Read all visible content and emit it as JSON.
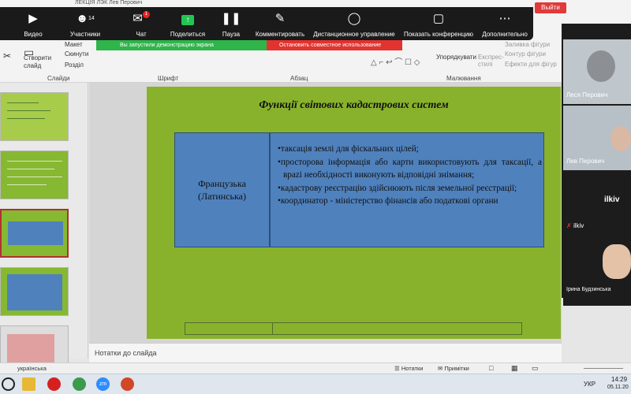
{
  "window": {
    "title_fragment": "ЛЕКЦІЯ ЛЭК   Лев Перович"
  },
  "zoom": {
    "buttons": [
      {
        "label": "Видео",
        "icon": "video-icon"
      },
      {
        "label": "Участники",
        "icon": "participants-icon",
        "count": "14"
      },
      {
        "label": "Чат",
        "icon": "chat-icon",
        "badge": "1"
      },
      {
        "label": "Поделиться",
        "icon": "share-icon"
      },
      {
        "label": "Пауза",
        "icon": "pause-icon"
      },
      {
        "label": "Комментировать",
        "icon": "annotate-icon"
      },
      {
        "label": "Дистанционное управление",
        "icon": "remote-control-icon"
      },
      {
        "label": "Показать конференцию",
        "icon": "show-meeting-icon"
      },
      {
        "label": "Дополнительно",
        "icon": "more-icon"
      }
    ],
    "leave_label": "Выйти",
    "sharing_text": "Вы запустили демонстрацию экрана",
    "stop_sharing_text": "Остановить совместное использование"
  },
  "ribbon": {
    "new_slide": "Створити слайд",
    "layout": "Макет",
    "reset": "Скинути",
    "section": "Розділ",
    "groups": [
      "Слайди",
      "Шрифт",
      "Абзац",
      "Малювання"
    ],
    "arrange": "Упорядкувати",
    "quick_styles": "Експрес-стилі",
    "shape_fill": "Заливка фігури",
    "shape_outline": "Контур фігури",
    "shape_effects": "Ефекти для фігур"
  },
  "slide": {
    "title": "Функції світових кадастрових систем",
    "left_cell": "Французька (Латинська)",
    "bullets": [
      "таксація землі для фіскальних цілей;",
      "просторова інформація або карти використовують для таксації, а врazi необхідності виконують відповідні знімання;",
      "кадастрову реєстрацію здійснюють після земельної реєстрації;",
      "координатор - міністерство фінансів або податкові органи"
    ]
  },
  "notes_placeholder": "Нотатки до слайда",
  "status": {
    "language": "українська",
    "notes": "Нотатки",
    "comments": "Примітки"
  },
  "taskbar": {
    "language": "УКР",
    "time": "14:29",
    "date": "05.11.20"
  },
  "participants": [
    {
      "name": "Леся Перович"
    },
    {
      "name": "Лев Перович"
    },
    {
      "name": "ilkiv"
    },
    {
      "name": "ilkiv"
    },
    {
      "name": "Ірина Будзинська"
    }
  ]
}
